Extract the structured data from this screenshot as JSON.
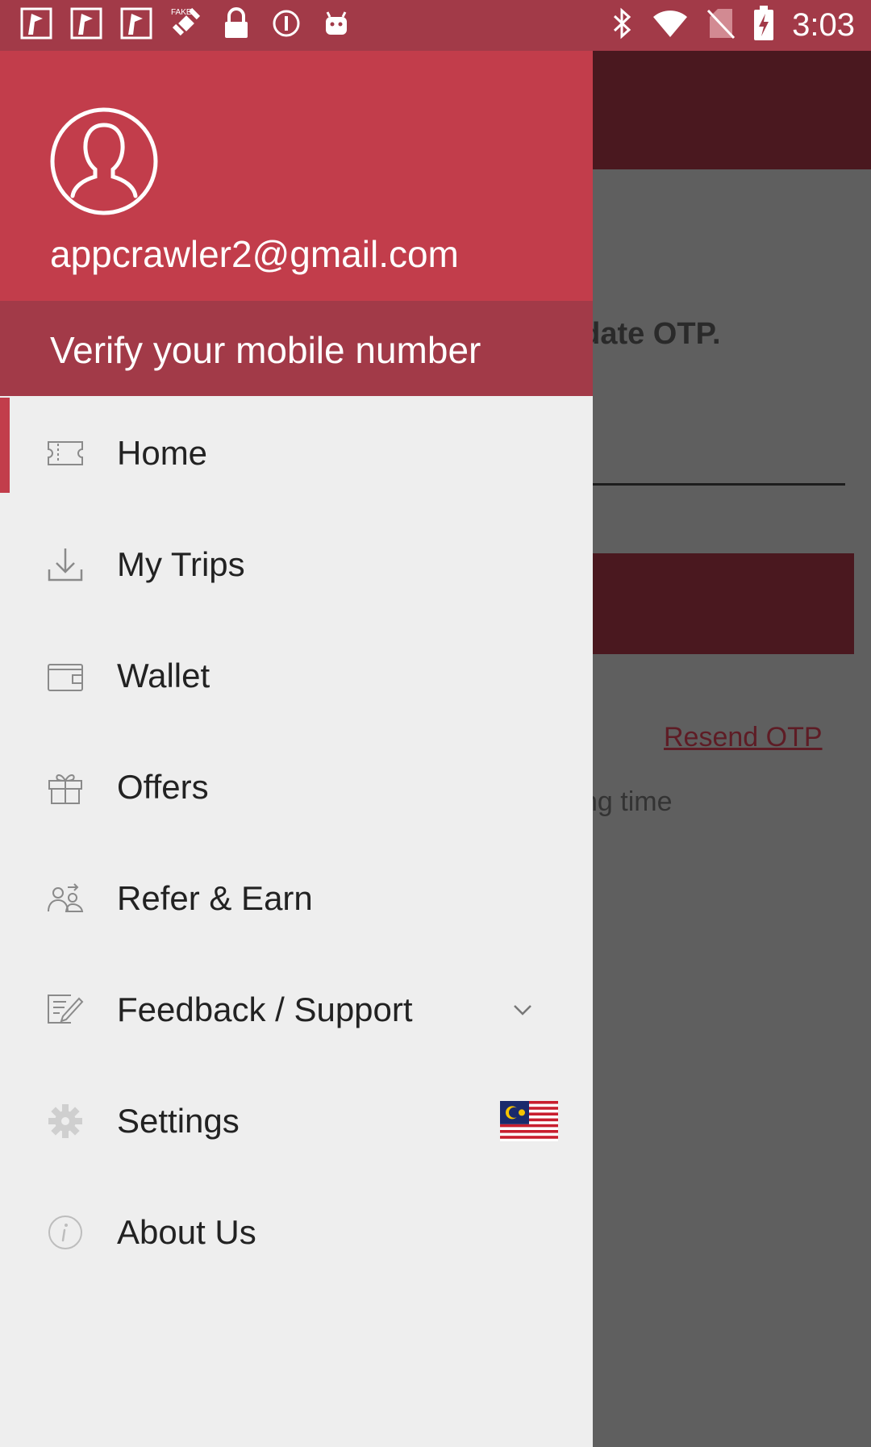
{
  "status_bar": {
    "time": "3:03",
    "left_icons": [
      "notification-icon",
      "notification-icon",
      "notification-icon",
      "fake-gps-icon",
      "lock-icon",
      "info-circle-icon",
      "android-icon"
    ],
    "right_icons": [
      "bluetooth-icon",
      "wifi-icon",
      "no-sim-icon",
      "battery-charging-icon"
    ]
  },
  "drawer": {
    "email": "appcrawler2@gmail.com",
    "verify_label": "Verify your mobile number",
    "items": [
      {
        "label": "Home",
        "icon": "ticket-icon",
        "active": true
      },
      {
        "label": "My Trips",
        "icon": "download-icon"
      },
      {
        "label": "Wallet",
        "icon": "wallet-icon"
      },
      {
        "label": "Offers",
        "icon": "gift-icon"
      },
      {
        "label": "Refer & Earn",
        "icon": "people-share-icon"
      },
      {
        "label": "Feedback / Support",
        "icon": "feedback-edit-icon"
      },
      {
        "label": "Settings",
        "icon": "gear-icon"
      },
      {
        "label": "About Us",
        "icon": "info-icon"
      }
    ],
    "settings_flag": "malaysia-flag-icon"
  },
  "background": {
    "validate_text": "lidate OTP.",
    "resend_label": "Resend OTP",
    "waiting_text": "ng time"
  },
  "colors": {
    "brand": "#c23d4b",
    "brand_dark": "#a23a48",
    "drawer_bg": "#eeeeee"
  }
}
